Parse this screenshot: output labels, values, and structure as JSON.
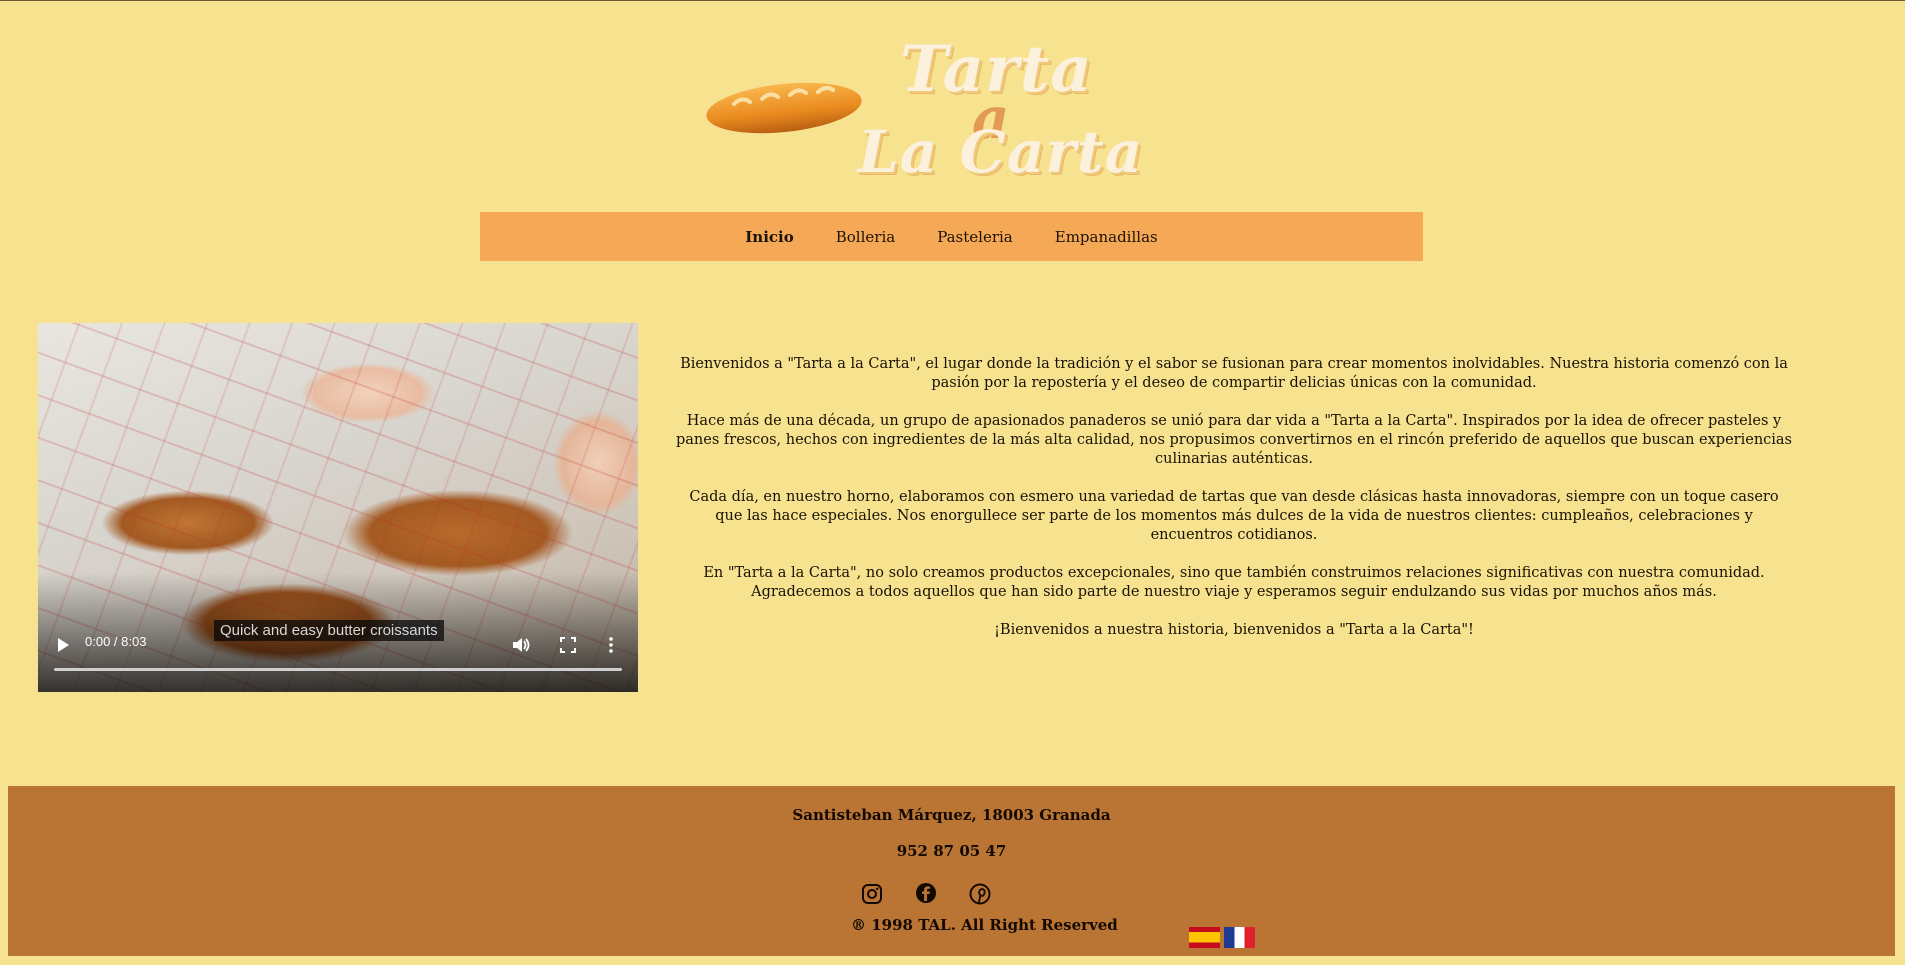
{
  "logo": {
    "line1": "Tarta",
    "line2": "a",
    "line3": "La Carta"
  },
  "nav": {
    "items": [
      "Inicio",
      "Bolleria",
      "Pasteleria",
      "Empanadillas"
    ],
    "active": "Inicio"
  },
  "video": {
    "caption": "Quick and easy butter croissants",
    "time": "0:00 / 8:03"
  },
  "story": {
    "paragraphs": [
      "Bienvenidos a \"Tarta a la Carta\", el lugar donde la tradición y el sabor se fusionan para crear momentos inolvidables. Nuestra historia comenzó con la pasión por la repostería y el deseo de compartir delicias únicas con la comunidad.",
      "Hace más de una década, un grupo de apasionados panaderos se unió para dar vida a \"Tarta a la Carta\". Inspirados por la idea de ofrecer pasteles y panes frescos, hechos con ingredientes de la más alta calidad, nos propusimos convertirnos en el rincón preferido de aquellos que buscan experiencias culinarias auténticas.",
      "Cada día, en nuestro horno, elaboramos con esmero una variedad de tartas que van desde clásicas hasta innovadoras, siempre con un toque casero que las hace especiales. Nos enorgullece ser parte de los momentos más dulces de la vida de nuestros clientes: cumpleaños, celebraciones y encuentros cotidianos.",
      "En \"Tarta a la Carta\", no solo creamos productos excepcionales, sino que también construimos relaciones significativas con nuestra comunidad. Agradecemos a todos aquellos que han sido parte de nuestro viaje y esperamos seguir endulzando sus vidas por muchos años más.",
      "¡Bienvenidos a nuestra historia, bienvenidos a \"Tarta a la Carta\"!"
    ]
  },
  "footer": {
    "address": "Santisteban Márquez, 18003 Granada",
    "phone": "952 87 05 47",
    "social": [
      "instagram-icon",
      "facebook-icon",
      "pinterest-icon"
    ],
    "copyright": "® 1998 TAL. All Right Reserved",
    "languages": [
      "es",
      "fr"
    ]
  },
  "colors": {
    "background": "#f6e28f",
    "nav": "#f5a956",
    "footer": "#ba7433"
  }
}
